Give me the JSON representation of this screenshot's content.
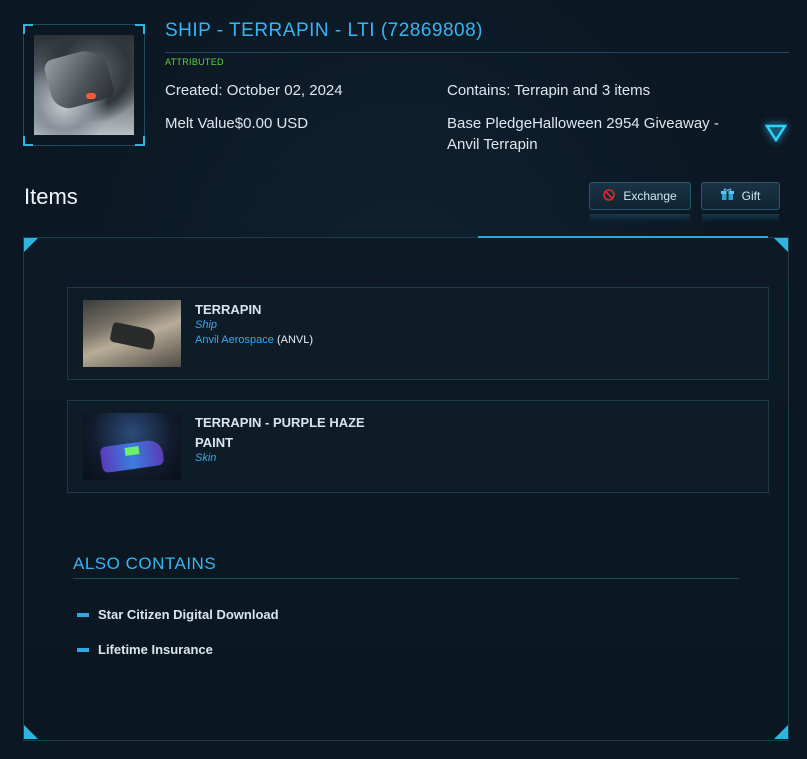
{
  "header": {
    "title": "SHIP - TERRAPIN - LTI (72869808)",
    "badge": "ATTRIBUTED",
    "created": "Created: October 02, 2024",
    "melt_value": "Melt Value$0.00 USD",
    "contains": "Contains: Terrapin and 3 items",
    "base_pledge": "Base PledgeHalloween 2954 Giveaway - Anvil Terrapin",
    "toggle_icon": "triangle-down-icon"
  },
  "items_section": {
    "heading": "Items",
    "actions": [
      {
        "label": "Exchange",
        "icon": "no-entry-icon"
      },
      {
        "label": "Gift",
        "icon": "gift-box-icon"
      }
    ]
  },
  "items": [
    {
      "title": "TERRAPIN",
      "type": "Ship",
      "manufacturer": "Anvil Aerospace",
      "code": "(ANVL)"
    },
    {
      "title": "TERRAPIN - PURPLE HAZE PAINT",
      "type": "Skin"
    }
  ],
  "also_contains": {
    "heading": "ALSO CONTAINS",
    "entries": [
      "Star Citizen Digital Download",
      "Lifetime Insurance"
    ]
  },
  "colors": {
    "accent": "#39b4f0",
    "badge": "#5fd33b",
    "background": "#0b1722"
  }
}
